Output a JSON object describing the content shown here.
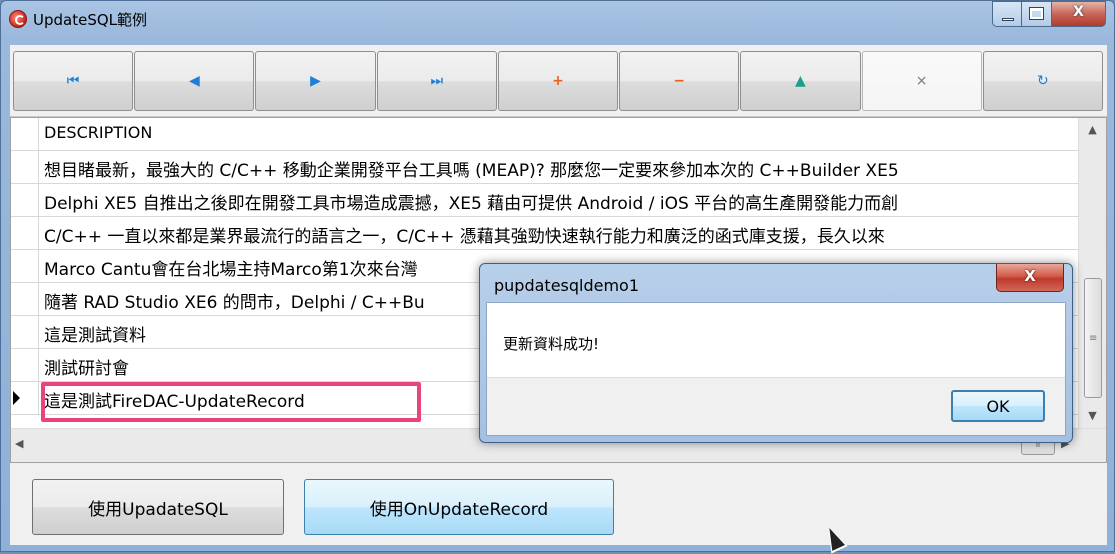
{
  "window": {
    "title": "UpdateSQL範例",
    "minimize_glyph": "",
    "maximize_glyph": "",
    "close_glyph": "X"
  },
  "navigator": {
    "buttons": [
      {
        "icon": "first-record-icon",
        "glyph": "⏮"
      },
      {
        "icon": "prior-record-icon",
        "glyph": "◀"
      },
      {
        "icon": "next-record-icon",
        "glyph": "▶"
      },
      {
        "icon": "last-record-icon",
        "glyph": "⏭"
      },
      {
        "icon": "insert-record-icon",
        "glyph": "+"
      },
      {
        "icon": "delete-record-icon",
        "glyph": "−"
      },
      {
        "icon": "edit-record-icon",
        "glyph": "▲"
      },
      {
        "icon": "cancel-edit-icon",
        "glyph": "×"
      },
      {
        "icon": "refresh-icon",
        "glyph": "↻"
      }
    ]
  },
  "grid": {
    "header": "DESCRIPTION",
    "rows": [
      "想目睹最新，最強大的 C/C++ 移動企業開發平台工具嗎 (MEAP)? 那麼您一定要來參加本次的 C++Builder XE5",
      "Delphi XE5 自推出之後即在開發工具市場造成震撼，XE5 藉由可提供 Android / iOS 平台的高生產開發能力而創",
      "C/C++ 一直以來都是業界最流行的語言之一，C/C++ 憑藉其強勁快速執行能力和廣泛的函式庫支援，長久以來",
      "Marco Cantu會在台北場主持Marco第1次來台灣",
      "隨著 RAD Studio XE6 的問市，Delphi / C++Bu",
      "這是測試資料",
      "測試研討會",
      "這是測試FireDAC-UpdateRecord"
    ],
    "current_row_index": 7
  },
  "buttons": {
    "use_updatesql": "使用UpadateSQL",
    "use_onupdaterecord": "使用OnUpdateRecord"
  },
  "dialog": {
    "title": "pupdatesqldemo1",
    "message": "更新資料成功!",
    "ok_label": "OK",
    "close_glyph": "X"
  },
  "colors": {
    "highlight_border": "#e8457a",
    "title_bar": "#a9c4e4"
  }
}
